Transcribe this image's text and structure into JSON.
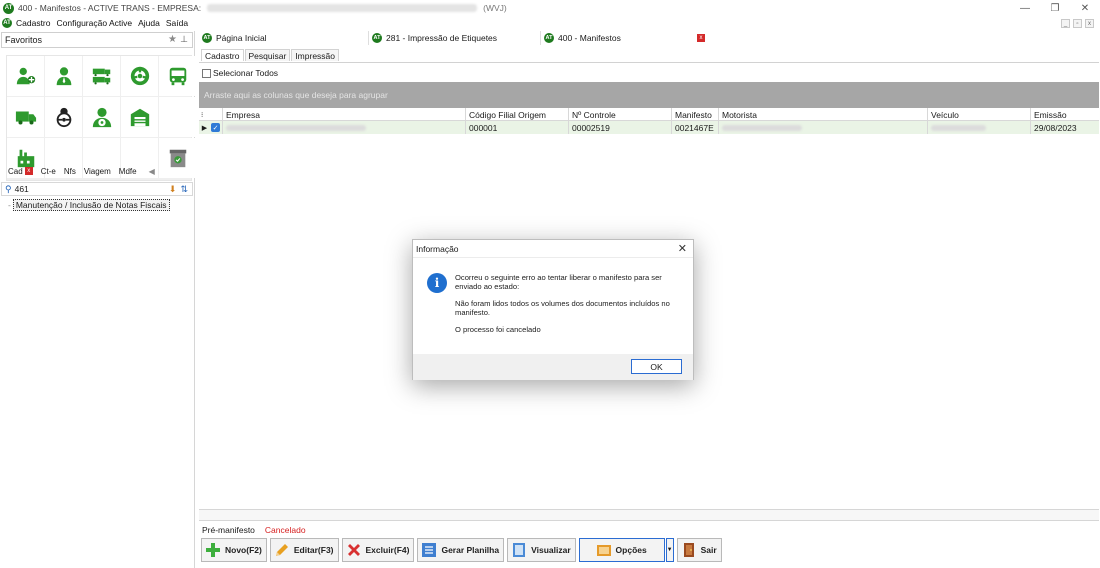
{
  "window": {
    "title_prefix": "400 - Manifestos - ACTIVE TRANS - EMPRESA:",
    "title_suffix": "(WVJ)",
    "logo_text": "AT",
    "minimize": "—",
    "restore": "❐",
    "close": "✕"
  },
  "menu": {
    "items": [
      "Cadastro",
      "Configuração Active",
      "Ajuda",
      "Saída"
    ]
  },
  "mdi": {
    "min": "_",
    "restore": "▫",
    "close": "x"
  },
  "sidebar": {
    "favorites_label": "Favoritos",
    "star": "★",
    "pin": "⊥",
    "tabs": [
      "Cad",
      "Ct-e",
      "Nfs",
      "Viagem",
      "Mdfe"
    ],
    "tab_close": "x",
    "tab_scroll": "◀",
    "search_value": "461",
    "search_icon": "⚲",
    "tool1": "⬇",
    "tool2": "⇅",
    "tree_item": "Manutenção / Inclusão de Notas Fiscais"
  },
  "doc_tabs": [
    {
      "label": "Página Inicial"
    },
    {
      "label": "281 - Impressão de Etiquetes"
    },
    {
      "label": "400 - Manifestos"
    }
  ],
  "doc_tab_close": "x",
  "sub_tabs": [
    "Cadastro",
    "Pesquisar",
    "Impressão"
  ],
  "grid": {
    "select_all": "Selecionar Todos",
    "group_hint": "Arraste aqui as colunas que deseja para agrupar",
    "columns": [
      "Empresa",
      "Código Filial Origem",
      "Nº Controle",
      "Manifesto",
      "Motorista",
      "Veículo",
      "Emissão"
    ],
    "row": {
      "indicator": "▶",
      "check": "✓",
      "codigo_filial": "000001",
      "controle": "00002519",
      "manifesto": "0021467E",
      "emissao": "29/08/2023"
    }
  },
  "status": {
    "label": "Pré-manifesto",
    "value": "Cancelado"
  },
  "toolbar": {
    "novo": "Novo(F2)",
    "editar": "Editar(F3)",
    "excluir": "Excluir(F4)",
    "planilha": "Gerar Planilha",
    "visualizar": "Visualizar",
    "opcoes": "Opções",
    "dropdown": "▼",
    "sair": "Sair"
  },
  "dialog": {
    "title": "Informação",
    "close": "✕",
    "icon": "i",
    "message1": "Ocorreu o seguinte erro ao tentar liberar o manifesto para ser enviado ao estado:",
    "message2": "Não foram lidos todos os volumes dos documentos incluídos no manifesto.",
    "message3": "O processo foi cancelado",
    "ok": "OK"
  },
  "colors": {
    "brand": "#1e7a1e",
    "accent": "#2b6cd2",
    "status_red": "#d62020",
    "row_selected": "#eaf4e6",
    "group_bar": "#a6a6a6"
  }
}
